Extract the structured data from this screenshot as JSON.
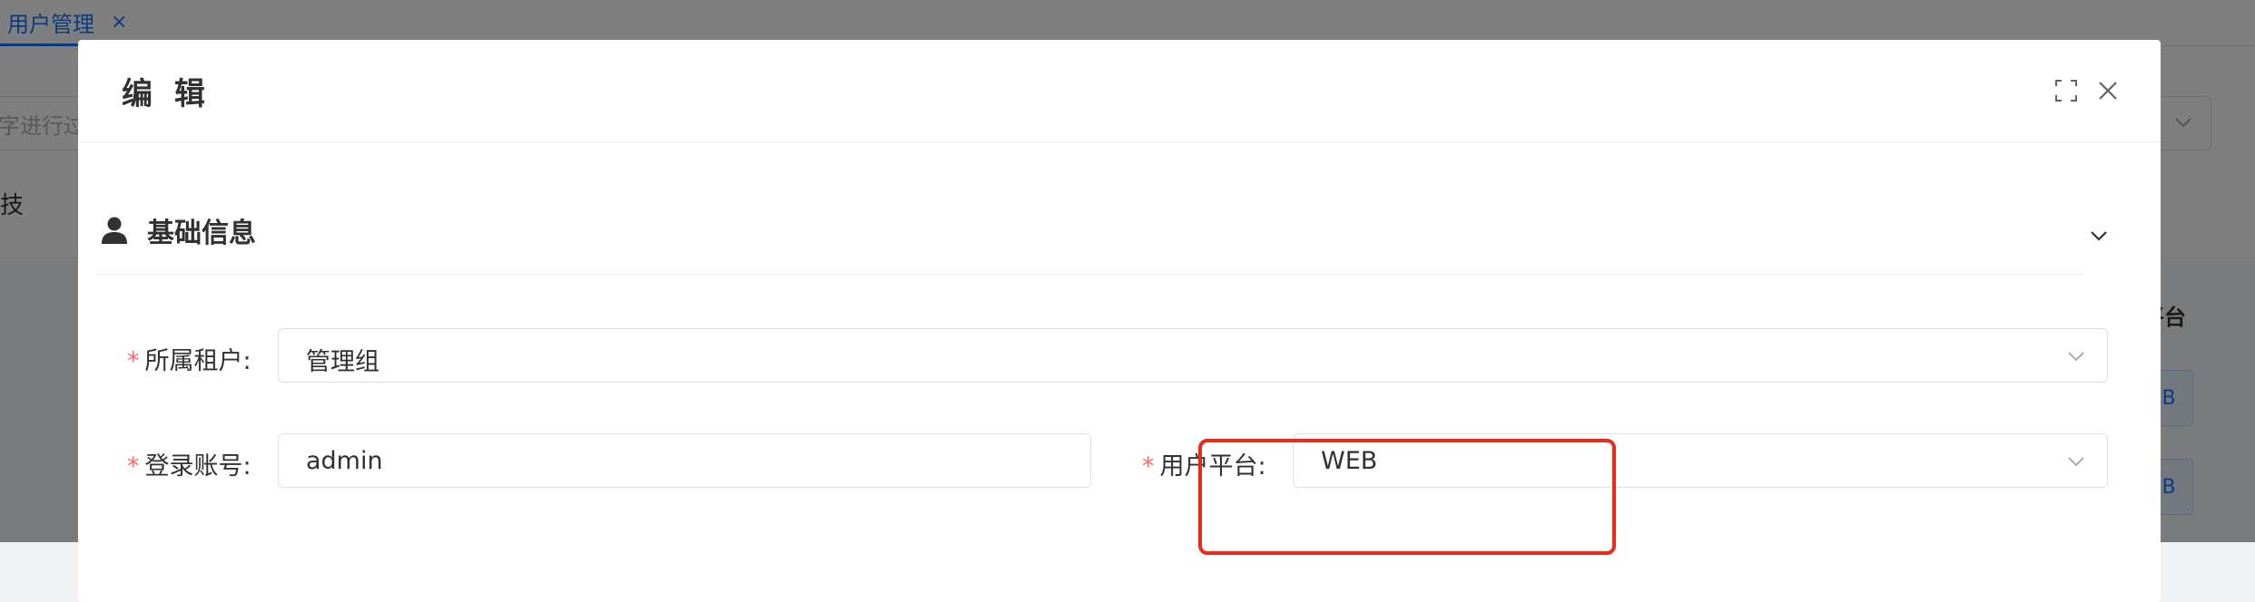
{
  "background": {
    "tab": {
      "label": "用户管理",
      "close": "×"
    },
    "search_placeholder": "字进行过",
    "row_text": "技",
    "column_header": "平台",
    "row_buttons": [
      "B",
      "B"
    ]
  },
  "modal": {
    "title": "编 辑",
    "section": {
      "title": "基础信息"
    },
    "fields": {
      "tenant": {
        "label": "所属租户:",
        "value": "管理组",
        "required": "*"
      },
      "account": {
        "label": "登录账号:",
        "value": "admin",
        "required": "*"
      },
      "platform": {
        "label": "用户平台:",
        "value": "WEB",
        "required": "*"
      }
    }
  },
  "colors": {
    "primary": "#1677ff",
    "required": "#f56c6c",
    "highlight": "#e8291c"
  },
  "icons": [
    "close-icon",
    "fullscreen-icon",
    "user-icon",
    "chevron-down-icon"
  ]
}
